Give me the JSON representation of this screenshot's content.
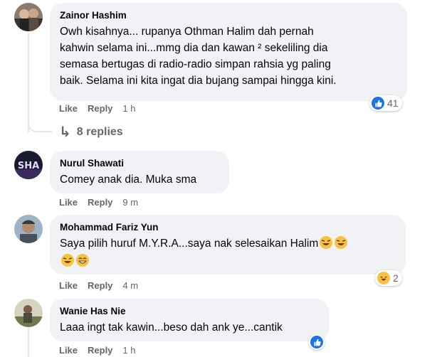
{
  "comments": [
    {
      "author": "Zainor Hashim",
      "lines": [
        "Owh kisahnya... rupanya Othman Halim dah pernah",
        "kahwin selama ini...mmg dia dan kawan ² sekeliling dia",
        "semasa bertugas di radio-radio simpan rahsia yg paling",
        "baik. Selama ini kita ingat dia bujang sampai hingga kini."
      ],
      "like": "Like",
      "reply": "Reply",
      "time": "1 h",
      "reaction_count": "41",
      "reaction_type": "like"
    },
    {
      "author": "Nurul Shawati",
      "lines": [
        "Comey anak dia. Muka sma"
      ],
      "like": "Like",
      "reply": "Reply",
      "time": "9 m"
    },
    {
      "author": "Mohammad Fariz Yun",
      "lines": [
        "Saya pilih huruf M.Y.R.A...saya nak selesaikan Halim"
      ],
      "like": "Like",
      "reply": "Reply",
      "time": "4 m",
      "reaction_count": "2",
      "reaction_type": "haha"
    },
    {
      "author": "Wanie Has Nie",
      "lines": [
        "Laaa ingt tak kawin...beso dah ank ye...cantik"
      ],
      "like": "Like",
      "reply": "Reply",
      "time": "1 h",
      "reaction_type": "like"
    }
  ],
  "replies_link": "8 replies",
  "colors": {
    "bubble": "#f0f2f5",
    "muted": "#65676b",
    "like_blue": "#1b74e4",
    "haha_yellow": "#f7c33e"
  }
}
